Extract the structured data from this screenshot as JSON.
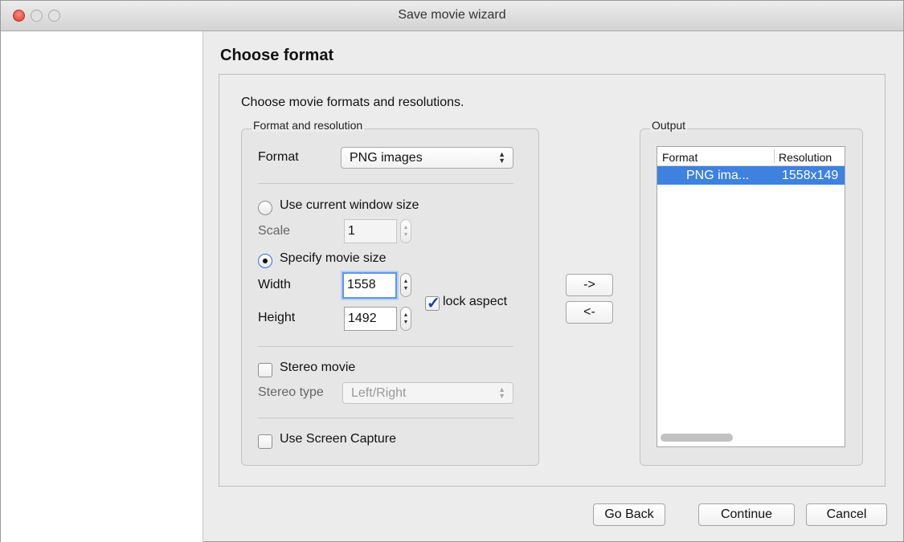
{
  "window": {
    "title": "Save movie wizard"
  },
  "page": {
    "heading": "Choose format",
    "intro": "Choose movie formats and resolutions."
  },
  "format_group": {
    "title": "Format and resolution",
    "format_label": "Format",
    "format_value": "PNG  images",
    "use_current_label": "Use current window size",
    "use_current_selected": false,
    "scale_label": "Scale",
    "scale_value": "1",
    "specify_label": "Specify movie size",
    "specify_selected": true,
    "width_label": "Width",
    "width_value": "1558",
    "height_label": "Height",
    "height_value": "1492",
    "lock_aspect_label": "lock aspect",
    "lock_aspect_checked": true,
    "stereo_label": "Stereo movie",
    "stereo_checked": false,
    "stereo_type_label": "Stereo type",
    "stereo_type_value": "Left/Right",
    "screen_capture_label": "Use Screen Capture",
    "screen_capture_checked": false
  },
  "transfer": {
    "add_label": "->",
    "remove_label": "<-"
  },
  "output_group": {
    "title": "Output",
    "columns": [
      "Format",
      "Resolution"
    ],
    "rows": [
      {
        "format": "PNG  ima...",
        "resolution": "1558x149"
      }
    ]
  },
  "footer": {
    "back_label": "Go Back",
    "continue_label": "Continue",
    "cancel_label": "Cancel"
  },
  "colors": {
    "selection": "#3f81de",
    "focus_ring": "#5d95e8",
    "close_button": "#d63b30"
  }
}
